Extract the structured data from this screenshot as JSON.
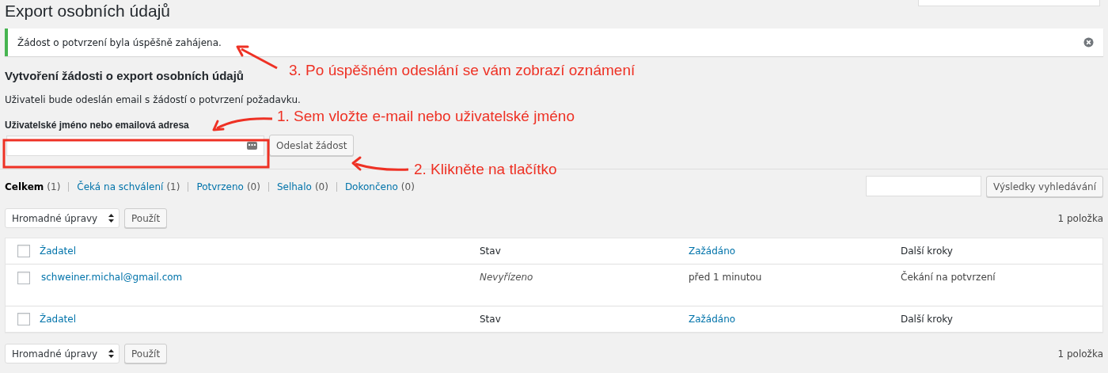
{
  "page": {
    "title": "Export osobních údajů"
  },
  "notice": {
    "message": "Žádost o potvrzení byla úspěšně zahájena.",
    "dismissible": true
  },
  "form": {
    "heading": "Vytvoření žádosti o export osobních údajů",
    "description": "Uživateli bude odeslán email s žádostí o potvrzení požadavku.",
    "label": "Uživatelské jméno nebo emailová adresa",
    "button": "Odeslat žádost"
  },
  "views": [
    {
      "label": "Celkem",
      "count": "(1)",
      "selected": true
    },
    {
      "label": "Čeká na schválení",
      "count": "(1)",
      "selected": false
    },
    {
      "label": "Potvrzeno",
      "count": "(0)",
      "selected": false
    },
    {
      "label": "Selhalo",
      "count": "(0)",
      "selected": false
    },
    {
      "label": "Dokončeno",
      "count": "(0)",
      "selected": false
    }
  ],
  "search": {
    "button": "Výsledky vyhledávání"
  },
  "bulk_top": {
    "select": "Hromadné úpravy",
    "apply": "Použít",
    "count": "1 položka"
  },
  "table": {
    "columns": [
      {
        "label": "Žadatel",
        "sortable": true
      },
      {
        "label": "Stav",
        "sortable": false
      },
      {
        "label": "Zažádáno",
        "sortable": true
      },
      {
        "label": "Další kroky",
        "sortable": false
      }
    ],
    "header_checked": false,
    "rows": [
      {
        "requester": "schweiner.michal@gmail.com",
        "status": "Nevyřízeno",
        "requested": "před 1 minutou",
        "next_steps": "Čekání na potvrzení",
        "checked": false
      }
    ],
    "footer_checked": false,
    "footer_columns": [
      {
        "label": "Žadatel",
        "sortable": true
      },
      {
        "label": "Stav",
        "sortable": false
      },
      {
        "label": "Zažádáno",
        "sortable": true
      },
      {
        "label": "Další kroky",
        "sortable": false
      }
    ]
  },
  "bulk_bottom": {
    "select": "Hromadné úpravy",
    "apply": "Použít",
    "count": "1 položka"
  },
  "annotations": [
    {
      "text": "3. Po úspěšném odeslání se vám zobrazí oznámení"
    },
    {
      "text": "1. Sem vložte e-mail nebo uživatelské jméno"
    },
    {
      "text": "2. Klikněte na tlačítko"
    }
  ]
}
